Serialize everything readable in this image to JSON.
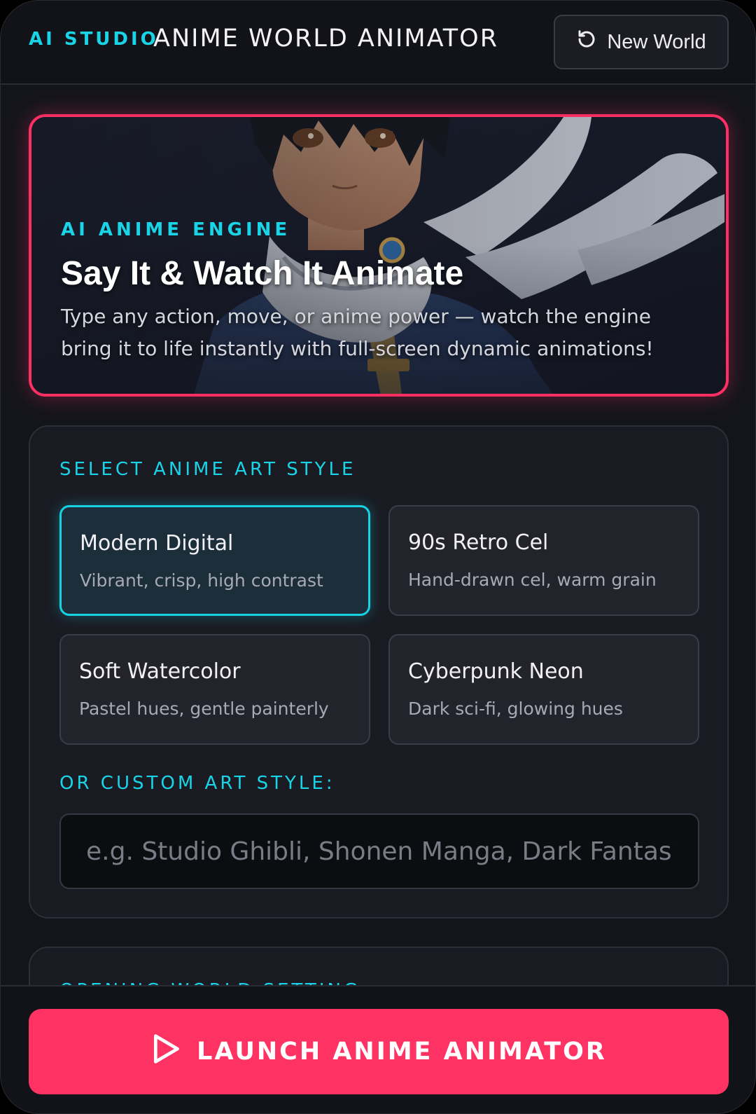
{
  "header": {
    "brand": "AI STUDIO",
    "title": "ANIME WORLD ANIMATOR",
    "new_world_label": "New World",
    "new_world_icon": "refresh-icon"
  },
  "hero": {
    "eyebrow": "AI ANIME ENGINE",
    "title": "Say It & Watch It Animate",
    "description": "Type any action, move, or anime power — watch the engine bring it to life instantly with full-screen dynamic animations!",
    "image": "anime-character-illustration"
  },
  "art_style": {
    "label": "SELECT ANIME ART STYLE",
    "selected": "Modern Digital",
    "options": [
      {
        "name": "Modern Digital",
        "desc": "Vibrant, crisp, high contrast"
      },
      {
        "name": "90s Retro Cel",
        "desc": "Hand-drawn cel, warm grain"
      },
      {
        "name": "Soft Watercolor",
        "desc": "Pastel hues, gentle painterly"
      },
      {
        "name": "Cyberpunk Neon",
        "desc": "Dark sci-fi, glowing hues"
      }
    ],
    "custom_label": "OR CUSTOM ART STYLE:",
    "custom_placeholder": "e.g. Studio Ghibli, Shonen Manga, Dark Fantasy",
    "custom_value": ""
  },
  "opening_world": {
    "label": "OPENING WORLD SETTING"
  },
  "footer": {
    "launch_label": "LAUNCH ANIME ANIMATOR",
    "launch_icon": "play-icon"
  },
  "colors": {
    "accent_cyan": "#19d3e6",
    "accent_pink": "#ff3363",
    "background": "#14151b",
    "panel": "#1a1b22"
  }
}
